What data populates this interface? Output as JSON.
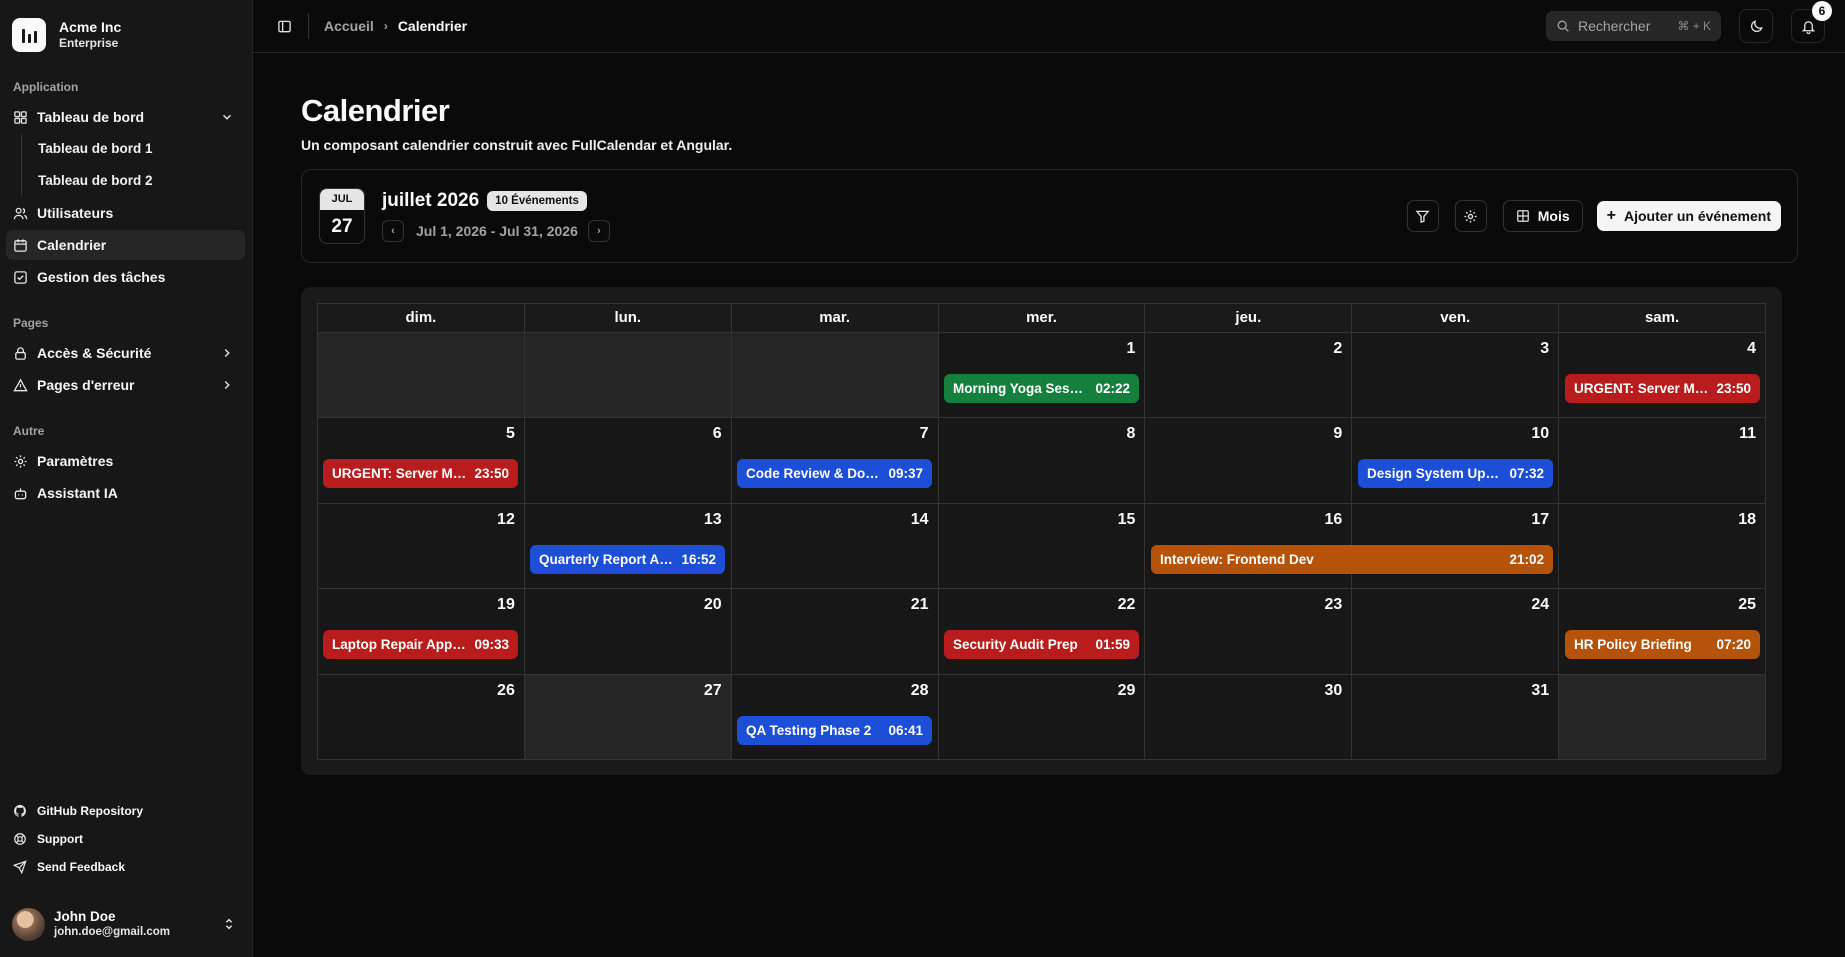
{
  "brand": {
    "name": "Acme Inc",
    "plan": "Enterprise"
  },
  "sidebar": {
    "groups": [
      {
        "label": "Application"
      },
      {
        "label": "Pages"
      },
      {
        "label": "Autre"
      }
    ],
    "items": {
      "dashboard": "Tableau de bord",
      "dashboard1": "Tableau de bord 1",
      "dashboard2": "Tableau de bord 2",
      "users": "Utilisateurs",
      "calendar": "Calendrier",
      "tasks": "Gestion des tâches",
      "access": "Accès & Sécurité",
      "errors": "Pages d'erreur",
      "settings": "Paramètres",
      "assistant": "Assistant IA"
    },
    "footer": {
      "github": "GitHub Repository",
      "support": "Support",
      "feedback": "Send Feedback"
    },
    "user": {
      "name": "John Doe",
      "email": "john.doe@gmail.com"
    }
  },
  "topbar": {
    "breadcrumb": [
      "Accueil",
      "Calendrier"
    ],
    "search_placeholder": "Rechercher",
    "search_shortcut": "⌘ + K",
    "notifications": "6"
  },
  "page": {
    "title": "Calendrier",
    "description": "Un composant calendrier construit avec FullCalendar et Angular."
  },
  "calendar": {
    "chip_month": "JUL",
    "chip_day": "27",
    "month_title": "juillet 2026",
    "event_count": "10 Événements",
    "range": "Jul 1, 2026 - Jul 31, 2026",
    "view_label": "Mois",
    "add_label": "Ajouter un événement",
    "weekdays": [
      "dim.",
      "lun.",
      "mar.",
      "mer.",
      "jeu.",
      "ven.",
      "sam."
    ],
    "weeks": [
      [
        "",
        "",
        "",
        "1",
        "2",
        "3",
        "4"
      ],
      [
        "5",
        "6",
        "7",
        "8",
        "9",
        "10",
        "11"
      ],
      [
        "12",
        "13",
        "14",
        "15",
        "16",
        "17",
        "18"
      ],
      [
        "19",
        "20",
        "21",
        "22",
        "23",
        "24",
        "25"
      ],
      [
        "26",
        "27",
        "28",
        "29",
        "30",
        "31",
        ""
      ]
    ],
    "events": [
      {
        "title": "Morning Yoga Sessi...",
        "time": "02:22",
        "color": "#15803d",
        "week": 0,
        "day": 3,
        "span": 1
      },
      {
        "title": "URGENT: Server Mai...",
        "time": "23:50",
        "color": "#b91c1c",
        "week": 0,
        "day": 6,
        "span": 1
      },
      {
        "title": "URGENT: Server Mai...",
        "time": "23:50",
        "color": "#b91c1c",
        "week": 1,
        "day": 0,
        "span": 1
      },
      {
        "title": "Code Review & Doc...",
        "time": "09:37",
        "color": "#1d4ed8",
        "week": 1,
        "day": 2,
        "span": 1
      },
      {
        "title": "Design System Upd...",
        "time": "07:32",
        "color": "#1d4ed8",
        "week": 1,
        "day": 5,
        "span": 1
      },
      {
        "title": "Quarterly Report An...",
        "time": "16:52",
        "color": "#1d4ed8",
        "week": 2,
        "day": 1,
        "span": 1
      },
      {
        "title": "Interview: Frontend Dev",
        "time": "21:02",
        "color": "#b45309",
        "week": 2,
        "day": 4,
        "span": 2
      },
      {
        "title": "Laptop Repair Appo...",
        "time": "09:33",
        "color": "#b91c1c",
        "week": 3,
        "day": 0,
        "span": 1
      },
      {
        "title": "Security Audit Prep",
        "time": "01:59",
        "color": "#b91c1c",
        "week": 3,
        "day": 3,
        "span": 1
      },
      {
        "title": "HR Policy Briefing",
        "time": "07:20",
        "color": "#b45309",
        "week": 3,
        "day": 6,
        "span": 1
      },
      {
        "title": "QA Testing Phase 2",
        "time": "06:41",
        "color": "#1d4ed8",
        "week": 4,
        "day": 2,
        "span": 1
      }
    ]
  }
}
